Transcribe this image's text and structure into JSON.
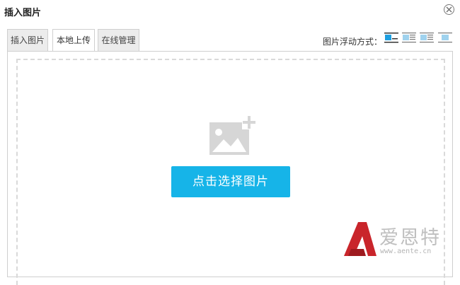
{
  "dialog": {
    "title": "插入图片"
  },
  "tabs": [
    {
      "label": "插入图片",
      "active": false
    },
    {
      "label": "本地上传",
      "active": true
    },
    {
      "label": "在线管理",
      "active": false
    }
  ],
  "float_options": {
    "label": "图片浮动方式：",
    "selected": "none",
    "options": [
      "none",
      "left",
      "center",
      "right"
    ]
  },
  "upload": {
    "button_label": "点击选择图片"
  },
  "watermark": {
    "brand": "爱恩特",
    "url": "www.aente.cn"
  },
  "colors": {
    "accent": "#16b4e8",
    "float_selected": "#1e9fe0",
    "logo_red": "#c9252b"
  }
}
